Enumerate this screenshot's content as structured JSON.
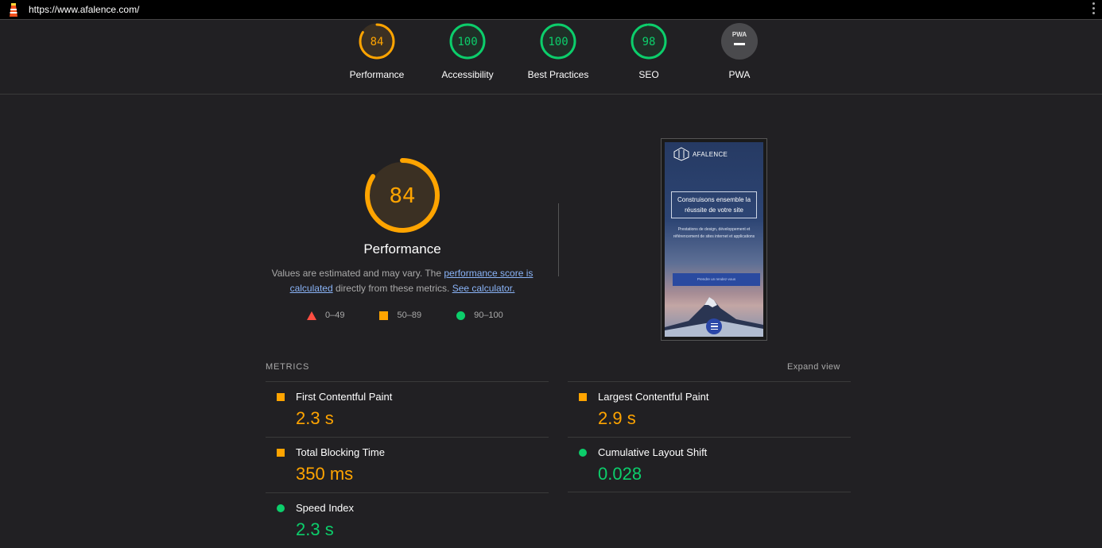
{
  "topbar": {
    "url": "https://www.afalence.com/"
  },
  "colors": {
    "average": "#ffa400",
    "pass": "#0cce6b",
    "fail": "#ff4e42",
    "na": "#4a4a4d"
  },
  "gauges": [
    {
      "label": "Performance",
      "score": "84",
      "value": 84,
      "status": "average"
    },
    {
      "label": "Accessibility",
      "score": "100",
      "value": 100,
      "status": "pass"
    },
    {
      "label": "Best Practices",
      "score": "100",
      "value": 100,
      "status": "pass"
    },
    {
      "label": "SEO",
      "score": "98",
      "value": 98,
      "status": "pass"
    },
    {
      "label": "PWA",
      "score": "PWA",
      "value": 0,
      "status": "na"
    }
  ],
  "performance": {
    "score": "84",
    "value": 84,
    "title": "Performance",
    "desc_prefix": "Values are estimated and may vary. The ",
    "desc_link1": "performance score is calculated",
    "desc_middle": " directly from these metrics. ",
    "desc_link2": "See calculator.",
    "legend": [
      {
        "shape": "triangle",
        "range": "0–49"
      },
      {
        "shape": "square",
        "range": "50–89"
      },
      {
        "shape": "circle",
        "range": "90–100"
      }
    ]
  },
  "screenshot": {
    "brand": "AFALENCE",
    "headline": "Construisons ensemble la réussite de votre site",
    "subtext": "Prestations de design, développement et référencement de sites internet et applications",
    "button": "Prendre un rendez-vous"
  },
  "metrics": {
    "header": "METRICS",
    "expand": "Expand view",
    "items": [
      {
        "name": "First Contentful Paint",
        "value": "2.3 s",
        "status": "average"
      },
      {
        "name": "Largest Contentful Paint",
        "value": "2.9 s",
        "status": "average"
      },
      {
        "name": "Total Blocking Time",
        "value": "350 ms",
        "status": "average"
      },
      {
        "name": "Cumulative Layout Shift",
        "value": "0.028",
        "status": "pass"
      },
      {
        "name": "Speed Index",
        "value": "2.3 s",
        "status": "pass"
      }
    ]
  }
}
